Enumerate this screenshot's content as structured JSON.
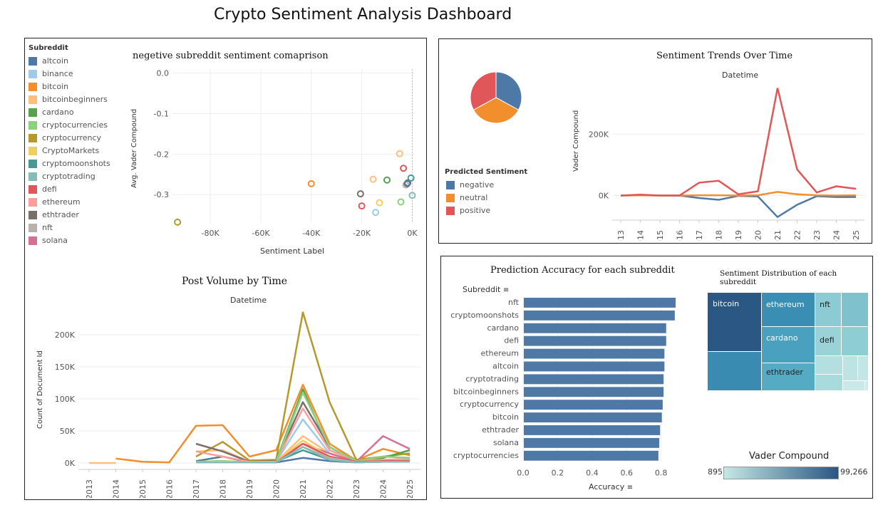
{
  "dashboard": {
    "title": "Crypto Sentiment Analysis Dashboard"
  },
  "subreddit_legend": {
    "title": "Subreddit",
    "items": [
      {
        "label": "altcoin",
        "color": "#4e79a7"
      },
      {
        "label": "binance",
        "color": "#a0cbe8"
      },
      {
        "label": "bitcoin",
        "color": "#f28e2b"
      },
      {
        "label": "bitcoinbeginners",
        "color": "#ffbe7d"
      },
      {
        "label": "cardano",
        "color": "#59a14f"
      },
      {
        "label": "cryptocurrencies",
        "color": "#8cd17d"
      },
      {
        "label": "cryptocurrency",
        "color": "#b6992d"
      },
      {
        "label": "CryptoMarkets",
        "color": "#f1ce63"
      },
      {
        "label": "cryptomoonshots",
        "color": "#499894"
      },
      {
        "label": "cryptotrading",
        "color": "#86bcb6"
      },
      {
        "label": "defi",
        "color": "#e15759"
      },
      {
        "label": "ethereum",
        "color": "#ff9d9a"
      },
      {
        "label": "ethtrader",
        "color": "#79706e"
      },
      {
        "label": "nft",
        "color": "#bab0ac"
      },
      {
        "label": "solana",
        "color": "#d37295"
      }
    ]
  },
  "scatter": {
    "title": "negetive subreddit sentiment comaprison",
    "xlabel": "Sentiment Label",
    "ylabel": "Avg. Vader Compound",
    "xticks": [
      "-80K",
      "-60K",
      "-40K",
      "-20K",
      "0K"
    ],
    "yticks": [
      "0.0",
      "-0.1",
      "-0.2",
      "-0.3"
    ]
  },
  "pie": {
    "legend_title": "Predicted Sentiment",
    "items": [
      {
        "label": "negative",
        "color": "#4e79a7"
      },
      {
        "label": "neutral",
        "color": "#f28e2b"
      },
      {
        "label": "positive",
        "color": "#e15759"
      }
    ]
  },
  "trends": {
    "title": "Sentiment Trends Over Time",
    "header": "Datetime",
    "ylabel": "Vader Compound",
    "yticks": [
      "200K",
      "0K"
    ]
  },
  "volume": {
    "title": "Post Volume by Time",
    "header": "Datetime",
    "ylabel": "Count of Document Id",
    "yticks": [
      "200K",
      "150K",
      "100K",
      "50K",
      "0K"
    ]
  },
  "accuracy": {
    "title": "Prediction Accuracy for each subreddit",
    "header": "Subreddit",
    "xlabel": "Accuracy",
    "xticks": [
      "0.0",
      "0.2",
      "0.4",
      "0.6",
      "0.8"
    ]
  },
  "treemap": {
    "title": "Sentiment Distribution of each subreddit",
    "labels": [
      "bitcoin",
      "ethereum",
      "nft",
      "cardano",
      "defi",
      "ethtrader"
    ],
    "color_legend_title": "Vader Compound",
    "min_label": "895",
    "max_label": "99,266"
  },
  "chart_data": [
    {
      "type": "scatter",
      "title": "negetive subreddit sentiment comaprison",
      "xlabel": "Sentiment Label",
      "ylabel": "Avg. Vader Compound",
      "xlim": [
        -95000,
        1000
      ],
      "ylim": [
        -0.37,
        0.01
      ],
      "points": [
        {
          "series": "cryptocurrency",
          "x": -93000,
          "y": -0.368
        },
        {
          "series": "bitcoin",
          "x": -40000,
          "y": -0.273
        },
        {
          "series": "ethtrader",
          "x": -20500,
          "y": -0.298
        },
        {
          "series": "defi",
          "x": -20000,
          "y": -0.328
        },
        {
          "series": "bitcoinbeginners",
          "x": -15500,
          "y": -0.262
        },
        {
          "series": "binance",
          "x": -14500,
          "y": -0.344
        },
        {
          "series": "CryptoMarkets",
          "x": -13000,
          "y": -0.32
        },
        {
          "series": "cardano",
          "x": -10000,
          "y": -0.264
        },
        {
          "series": "cryptocurrencies",
          "x": -4500,
          "y": -0.318
        },
        {
          "series": "bitcoinbeginners",
          "x": -5000,
          "y": -0.199
        },
        {
          "series": "defi",
          "x": -3500,
          "y": -0.235
        },
        {
          "series": "nft",
          "x": -2500,
          "y": -0.276
        },
        {
          "series": "ethtrader",
          "x": -2000,
          "y": -0.273
        },
        {
          "series": "altcoin",
          "x": -1800,
          "y": -0.271
        },
        {
          "series": "cryptomoonshots",
          "x": -500,
          "y": -0.259
        },
        {
          "series": "cryptotrading",
          "x": 0,
          "y": -0.302
        }
      ]
    },
    {
      "type": "pie",
      "slices": [
        {
          "label": "negative",
          "value": 33
        },
        {
          "label": "neutral",
          "value": 34
        },
        {
          "label": "positive",
          "value": 33
        }
      ]
    },
    {
      "type": "line",
      "title": "Sentiment Trends Over Time",
      "ylabel": "Vader Compound",
      "x": [
        "2013",
        "2014",
        "2015",
        "2016",
        "2017",
        "2018",
        "2019",
        "2020",
        "2021",
        "2022",
        "2023",
        "2024",
        "2025"
      ],
      "ylim": [
        -80000,
        370000
      ],
      "series": [
        {
          "name": "negative",
          "color": "#4e79a7",
          "values": [
            0,
            1000,
            0,
            0,
            -8000,
            -14000,
            -1000,
            -3000,
            -70000,
            -30000,
            -2000,
            -5000,
            -5000
          ]
        },
        {
          "name": "neutral",
          "color": "#f28e2b",
          "values": [
            0,
            1000,
            0,
            0,
            1000,
            1000,
            0,
            1000,
            12000,
            4000,
            1000,
            0,
            1000
          ]
        },
        {
          "name": "positive",
          "color": "#e15759",
          "values": [
            0,
            3000,
            0,
            0,
            42000,
            48000,
            4000,
            14000,
            350000,
            85000,
            10000,
            30000,
            22000
          ]
        }
      ]
    },
    {
      "type": "line",
      "title": "Post Volume by Time",
      "ylabel": "Count of Document Id",
      "x": [
        "2013",
        "2014",
        "2015",
        "2016",
        "2017",
        "2018",
        "2019",
        "2020",
        "2021",
        "2022",
        "2023",
        "2024",
        "2025"
      ],
      "ylim": [
        -10000,
        240000
      ],
      "series": [
        {
          "name": "bitcoinbeginners",
          "values": [
            0,
            0,
            null,
            null,
            18000,
            20000,
            2000,
            2000,
            42000,
            15000,
            2000,
            4000,
            8000
          ]
        },
        {
          "name": "altcoin",
          "values": [
            null,
            0,
            null,
            null,
            3000,
            10000,
            1000,
            1000,
            8000,
            3000,
            1000,
            2000,
            2000
          ]
        },
        {
          "name": "bitcoin",
          "values": [
            null,
            7000,
            2000,
            1000,
            58000,
            59000,
            10000,
            20000,
            122000,
            30000,
            4000,
            22000,
            12000
          ]
        },
        {
          "name": "cryptocurrency",
          "values": [
            null,
            null,
            null,
            null,
            10000,
            33000,
            4000,
            5000,
            235000,
            95000,
            5000,
            10000,
            15000
          ]
        },
        {
          "name": "cardano",
          "values": [
            null,
            null,
            null,
            null,
            2000,
            3000,
            1000,
            3000,
            115000,
            20000,
            3000,
            8000,
            20000
          ]
        },
        {
          "name": "ethtrader",
          "values": [
            null,
            null,
            null,
            null,
            30000,
            18000,
            2000,
            3000,
            95000,
            25000,
            2000,
            5000,
            5000
          ]
        },
        {
          "name": "binance",
          "values": [
            null,
            null,
            null,
            null,
            1000,
            2000,
            1000,
            2000,
            68000,
            15000,
            2000,
            4000,
            6000
          ]
        },
        {
          "name": "ethereum",
          "values": [
            null,
            null,
            null,
            null,
            18000,
            10000,
            2000,
            2000,
            85000,
            20000,
            3000,
            5000,
            5000
          ]
        },
        {
          "name": "solana",
          "values": [
            null,
            null,
            null,
            null,
            null,
            null,
            null,
            3000,
            30000,
            15000,
            2000,
            42000,
            22000
          ]
        },
        {
          "name": "cryptocurrencies",
          "values": [
            null,
            null,
            null,
            null,
            2000,
            3000,
            1000,
            2000,
            110000,
            25000,
            3000,
            10000,
            8000
          ]
        },
        {
          "name": "CryptoMarkets",
          "values": [
            null,
            null,
            null,
            null,
            1000,
            2000,
            1000,
            2000,
            35000,
            10000,
            2000,
            3000,
            3000
          ]
        },
        {
          "name": "cryptomoonshots",
          "values": [
            null,
            null,
            null,
            null,
            null,
            null,
            null,
            2000,
            20000,
            5000,
            1000,
            2000,
            2000
          ]
        },
        {
          "name": "defi",
          "values": [
            null,
            null,
            null,
            null,
            null,
            null,
            null,
            1000,
            30000,
            10000,
            2000,
            3000,
            3000
          ]
        },
        {
          "name": "nft",
          "values": [
            null,
            null,
            null,
            null,
            null,
            null,
            null,
            1000,
            25000,
            8000,
            1000,
            2000,
            2000
          ]
        },
        {
          "name": "cryptotrading",
          "values": [
            null,
            null,
            null,
            null,
            1000,
            1000,
            1000,
            1000,
            25000,
            5000,
            1000,
            2000,
            2000
          ]
        }
      ]
    },
    {
      "type": "bar",
      "orientation": "horizontal",
      "title": "Prediction Accuracy for each subreddit",
      "xlabel": "Accuracy",
      "xlim": [
        0,
        0.95
      ],
      "categories": [
        "nft",
        "cryptomoonshots",
        "cardano",
        "defi",
        "ethereum",
        "altcoin",
        "cryptotrading",
        "bitcoinbeginners",
        "cryptocurrency",
        "bitcoin",
        "ethtrader",
        "solana",
        "cryptocurrencies"
      ],
      "values": [
        0.88,
        0.875,
        0.825,
        0.825,
        0.815,
        0.815,
        0.81,
        0.81,
        0.805,
        0.8,
        0.79,
        0.785,
        0.78
      ]
    },
    {
      "type": "heatmap",
      "title": "Sentiment Distribution of each subreddit",
      "color_label": "Vader Compound",
      "color_range": [
        895,
        99266
      ],
      "cells": [
        {
          "label": "bitcoin",
          "value": 99266
        },
        {
          "label": "ethereum",
          "value": 62000
        },
        {
          "label": "cardano",
          "value": 55000
        },
        {
          "label": "ethtrader",
          "value": 45000
        },
        {
          "label": "nft",
          "value": 18000
        },
        {
          "label": "defi",
          "value": 15000
        }
      ]
    }
  ]
}
